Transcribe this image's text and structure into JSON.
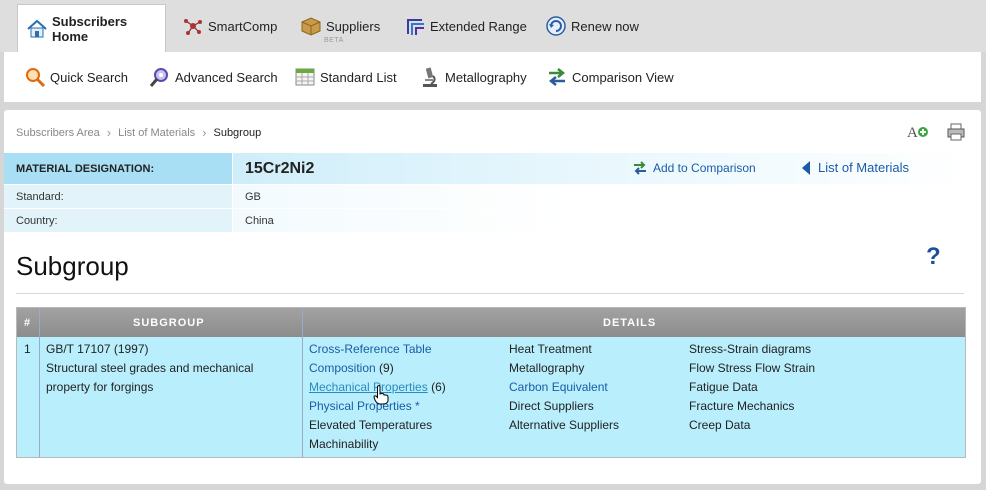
{
  "top_tabs": [
    {
      "label": "Subscribers Home",
      "icon": "home-icon"
    },
    {
      "label": "SmartComp",
      "icon": "molecule-icon"
    },
    {
      "label": "Suppliers",
      "icon": "box-icon",
      "badge": "BETA"
    },
    {
      "label": "Extended Range",
      "icon": "stacked-layers-icon"
    },
    {
      "label": "Renew now",
      "icon": "refresh-icon"
    }
  ],
  "sub_toolbar": [
    {
      "label": "Quick Search",
      "icon": "magnifier-icon"
    },
    {
      "label": "Advanced Search",
      "icon": "advanced-search-icon"
    },
    {
      "label": "Standard List",
      "icon": "table-icon"
    },
    {
      "label": "Metallography",
      "icon": "microscope-icon"
    },
    {
      "label": "Comparison View",
      "icon": "compare-arrows-icon"
    }
  ],
  "breadcrumb": [
    "Subscribers Area",
    "List of Materials",
    "Subgroup"
  ],
  "material": {
    "designation_label": "MATERIAL DESIGNATION:",
    "designation_value": "15Cr2Ni2",
    "standard_label": "Standard:",
    "standard_value": "GB",
    "country_label": "Country:",
    "country_value": "China",
    "add_to_comparison": "Add to Comparison",
    "list_of_materials": "List of Materials"
  },
  "page_title": "Subgroup",
  "help_glyph": "?",
  "table": {
    "headers": [
      "#",
      "SUBGROUP",
      "DETAILS"
    ],
    "rows": [
      {
        "index": "1",
        "subgroup_code": "GB/T 17107 (1997)",
        "subgroup_desc": "Structural steel grades and mechanical property for forgings",
        "details": {
          "col1": [
            {
              "text": "Cross-Reference Table",
              "link": true
            },
            {
              "text": "Composition",
              "link": true,
              "count": "(9)"
            },
            {
              "text": "Mechanical Properties",
              "link": true,
              "count": "(6)",
              "hover": true
            },
            {
              "text": "Physical Properties *",
              "link": true
            },
            {
              "text": "Elevated Temperatures",
              "link": false
            },
            {
              "text": "Machinability",
              "link": false
            }
          ],
          "col2": [
            {
              "text": "Heat Treatment",
              "link": false
            },
            {
              "text": "Metallography",
              "link": false
            },
            {
              "text": "Carbon Equivalent",
              "link": true
            },
            {
              "text": "Direct Suppliers",
              "link": false
            },
            {
              "text": "Alternative Suppliers",
              "link": false
            }
          ],
          "col3": [
            {
              "text": "Stress-Strain diagrams",
              "link": false
            },
            {
              "text": "Flow Stress Flow Strain",
              "link": false
            },
            {
              "text": "Fatigue Data",
              "link": false
            },
            {
              "text": "Fracture Mechanics",
              "link": false
            },
            {
              "text": "Creep Data",
              "link": false
            }
          ]
        }
      }
    ]
  },
  "colors": {
    "link": "#1a5ca8",
    "row_highlight": "#b9eefc",
    "designation_bg": "#a9dff4",
    "header_gray": "#969696"
  }
}
